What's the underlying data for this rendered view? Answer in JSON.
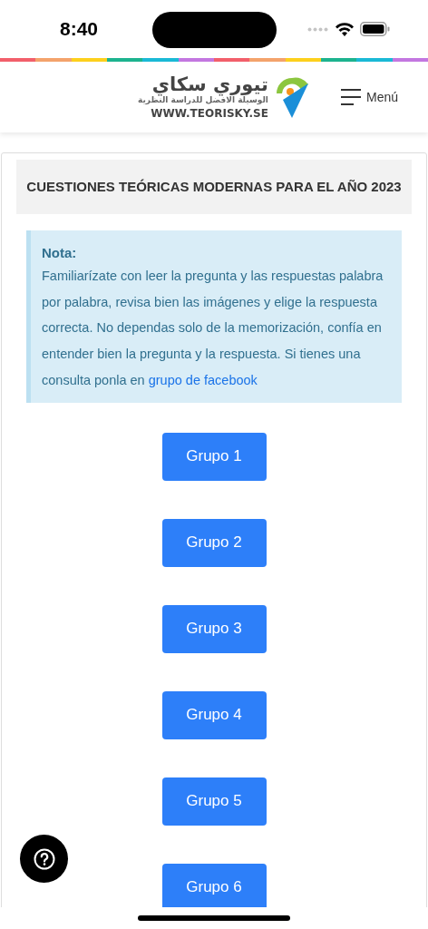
{
  "status_bar": {
    "time": "8:40"
  },
  "header": {
    "logo": {
      "title": "تيوري سكاي",
      "tagline": "الوسيلة الافضل للدراسة النظرية",
      "url": "WWW.TEORISKY.SE"
    },
    "menu_label": "Menú"
  },
  "page_title": "CUESTIONES TEÓRICAS MODERNAS PARA EL AÑO 2023",
  "note": {
    "heading": "Nota:",
    "text": "Familiarízate con leer la pregunta y las respuestas palabra por palabra, revisa bien las imágenes y elige la respuesta correcta. No dependas solo de la memorización, confía en entender bien la pregunta y la respuesta. Si tienes una consulta ponla en",
    "link": "grupo de facebook"
  },
  "groups": [
    {
      "label": "Grupo 1"
    },
    {
      "label": "Grupo 2"
    },
    {
      "label": "Grupo 3"
    },
    {
      "label": "Grupo 4"
    },
    {
      "label": "Grupo 5"
    },
    {
      "label": "Grupo 6"
    }
  ]
}
